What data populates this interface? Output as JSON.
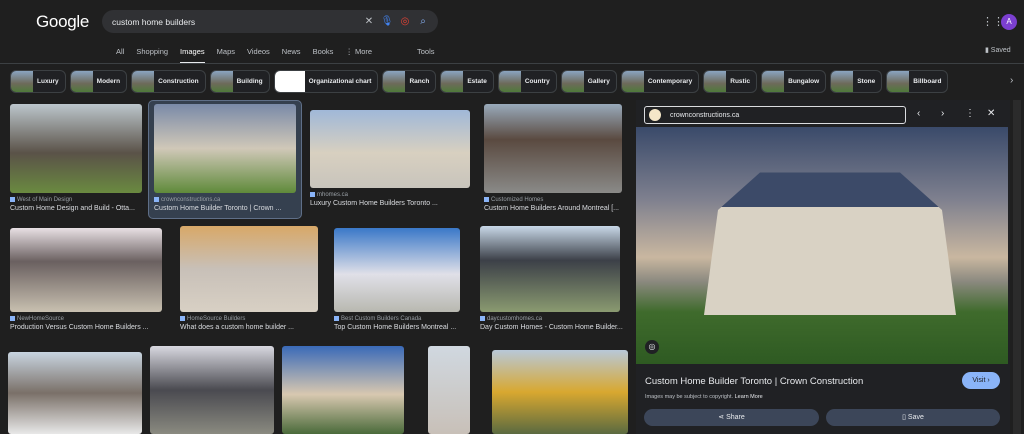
{
  "header": {
    "logo": "Google",
    "query": "custom home builders",
    "apps_icon": "grid-icon",
    "avatar": "A",
    "saved": "Saved"
  },
  "tabs": [
    "All",
    "Shopping",
    "Images",
    "Maps",
    "Videos",
    "News",
    "Books",
    "⋮ More"
  ],
  "active_tab": "Images",
  "tools": "Tools",
  "chips": [
    "Luxury",
    "Modern",
    "Construction",
    "Building",
    "Organizational chart",
    "Ranch",
    "Estate",
    "Country",
    "Gallery",
    "Contemporary",
    "Rustic",
    "Bungalow",
    "Stone",
    "Billboard"
  ],
  "results": [
    {
      "source": "West of Main Design",
      "title": "Custom Home Design and Build - Otta..."
    },
    {
      "source": "crownconstructions.ca",
      "title": "Custom Home Builder Toronto | Crown ..."
    },
    {
      "source": "mhomes.ca",
      "title": "Luxury Custom Home Builders Toronto ..."
    },
    {
      "source": "Customized Homes",
      "title": "Custom Home Builders Around Montreal [..."
    },
    {
      "source": "NewHomeSource",
      "title": "Production Versus Custom Home Builders ..."
    },
    {
      "source": "HomeSource Builders",
      "title": "What does a custom home builder ..."
    },
    {
      "source": "Best Custom Builders Canada",
      "title": "Top Custom Home Builders Montreal ..."
    },
    {
      "source": "daycustomhomes.ca",
      "title": "Day Custom Homes - Custom Home Builder..."
    }
  ],
  "panel": {
    "source": "crownconstructions.ca",
    "title": "Custom Home Builder Toronto | Crown Construction",
    "visit": "Visit ›",
    "copyright": "Images may be subject to copyright.",
    "learn_more": "Learn More",
    "share": "Share",
    "save": "Save"
  },
  "colors": {
    "background": "#1f1f1f",
    "accent": "#8ab4f8",
    "selected": "#35404f"
  }
}
